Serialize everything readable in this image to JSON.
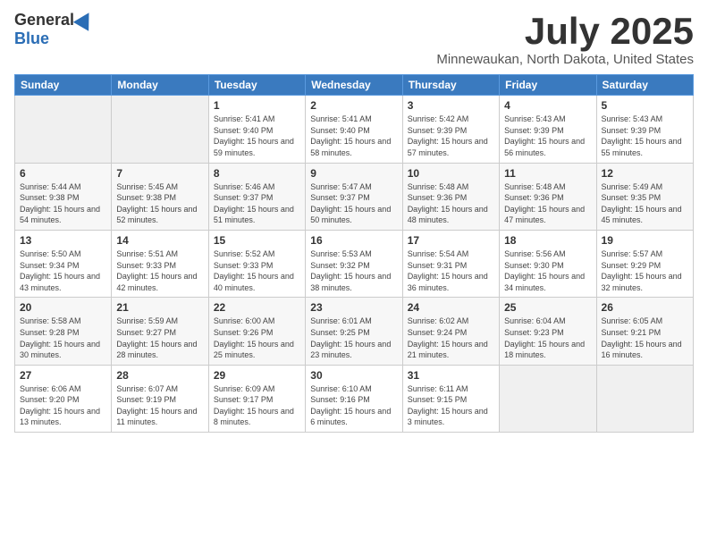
{
  "logo": {
    "general": "General",
    "blue": "Blue"
  },
  "title": "July 2025",
  "location": "Minnewaukan, North Dakota, United States",
  "days_of_week": [
    "Sunday",
    "Monday",
    "Tuesday",
    "Wednesday",
    "Thursday",
    "Friday",
    "Saturday"
  ],
  "weeks": [
    [
      {
        "day": "",
        "info": ""
      },
      {
        "day": "",
        "info": ""
      },
      {
        "day": "1",
        "info": "Sunrise: 5:41 AM\nSunset: 9:40 PM\nDaylight: 15 hours and 59 minutes."
      },
      {
        "day": "2",
        "info": "Sunrise: 5:41 AM\nSunset: 9:40 PM\nDaylight: 15 hours and 58 minutes."
      },
      {
        "day": "3",
        "info": "Sunrise: 5:42 AM\nSunset: 9:39 PM\nDaylight: 15 hours and 57 minutes."
      },
      {
        "day": "4",
        "info": "Sunrise: 5:43 AM\nSunset: 9:39 PM\nDaylight: 15 hours and 56 minutes."
      },
      {
        "day": "5",
        "info": "Sunrise: 5:43 AM\nSunset: 9:39 PM\nDaylight: 15 hours and 55 minutes."
      }
    ],
    [
      {
        "day": "6",
        "info": "Sunrise: 5:44 AM\nSunset: 9:38 PM\nDaylight: 15 hours and 54 minutes."
      },
      {
        "day": "7",
        "info": "Sunrise: 5:45 AM\nSunset: 9:38 PM\nDaylight: 15 hours and 52 minutes."
      },
      {
        "day": "8",
        "info": "Sunrise: 5:46 AM\nSunset: 9:37 PM\nDaylight: 15 hours and 51 minutes."
      },
      {
        "day": "9",
        "info": "Sunrise: 5:47 AM\nSunset: 9:37 PM\nDaylight: 15 hours and 50 minutes."
      },
      {
        "day": "10",
        "info": "Sunrise: 5:48 AM\nSunset: 9:36 PM\nDaylight: 15 hours and 48 minutes."
      },
      {
        "day": "11",
        "info": "Sunrise: 5:48 AM\nSunset: 9:36 PM\nDaylight: 15 hours and 47 minutes."
      },
      {
        "day": "12",
        "info": "Sunrise: 5:49 AM\nSunset: 9:35 PM\nDaylight: 15 hours and 45 minutes."
      }
    ],
    [
      {
        "day": "13",
        "info": "Sunrise: 5:50 AM\nSunset: 9:34 PM\nDaylight: 15 hours and 43 minutes."
      },
      {
        "day": "14",
        "info": "Sunrise: 5:51 AM\nSunset: 9:33 PM\nDaylight: 15 hours and 42 minutes."
      },
      {
        "day": "15",
        "info": "Sunrise: 5:52 AM\nSunset: 9:33 PM\nDaylight: 15 hours and 40 minutes."
      },
      {
        "day": "16",
        "info": "Sunrise: 5:53 AM\nSunset: 9:32 PM\nDaylight: 15 hours and 38 minutes."
      },
      {
        "day": "17",
        "info": "Sunrise: 5:54 AM\nSunset: 9:31 PM\nDaylight: 15 hours and 36 minutes."
      },
      {
        "day": "18",
        "info": "Sunrise: 5:56 AM\nSunset: 9:30 PM\nDaylight: 15 hours and 34 minutes."
      },
      {
        "day": "19",
        "info": "Sunrise: 5:57 AM\nSunset: 9:29 PM\nDaylight: 15 hours and 32 minutes."
      }
    ],
    [
      {
        "day": "20",
        "info": "Sunrise: 5:58 AM\nSunset: 9:28 PM\nDaylight: 15 hours and 30 minutes."
      },
      {
        "day": "21",
        "info": "Sunrise: 5:59 AM\nSunset: 9:27 PM\nDaylight: 15 hours and 28 minutes."
      },
      {
        "day": "22",
        "info": "Sunrise: 6:00 AM\nSunset: 9:26 PM\nDaylight: 15 hours and 25 minutes."
      },
      {
        "day": "23",
        "info": "Sunrise: 6:01 AM\nSunset: 9:25 PM\nDaylight: 15 hours and 23 minutes."
      },
      {
        "day": "24",
        "info": "Sunrise: 6:02 AM\nSunset: 9:24 PM\nDaylight: 15 hours and 21 minutes."
      },
      {
        "day": "25",
        "info": "Sunrise: 6:04 AM\nSunset: 9:23 PM\nDaylight: 15 hours and 18 minutes."
      },
      {
        "day": "26",
        "info": "Sunrise: 6:05 AM\nSunset: 9:21 PM\nDaylight: 15 hours and 16 minutes."
      }
    ],
    [
      {
        "day": "27",
        "info": "Sunrise: 6:06 AM\nSunset: 9:20 PM\nDaylight: 15 hours and 13 minutes."
      },
      {
        "day": "28",
        "info": "Sunrise: 6:07 AM\nSunset: 9:19 PM\nDaylight: 15 hours and 11 minutes."
      },
      {
        "day": "29",
        "info": "Sunrise: 6:09 AM\nSunset: 9:17 PM\nDaylight: 15 hours and 8 minutes."
      },
      {
        "day": "30",
        "info": "Sunrise: 6:10 AM\nSunset: 9:16 PM\nDaylight: 15 hours and 6 minutes."
      },
      {
        "day": "31",
        "info": "Sunrise: 6:11 AM\nSunset: 9:15 PM\nDaylight: 15 hours and 3 minutes."
      },
      {
        "day": "",
        "info": ""
      },
      {
        "day": "",
        "info": ""
      }
    ]
  ]
}
